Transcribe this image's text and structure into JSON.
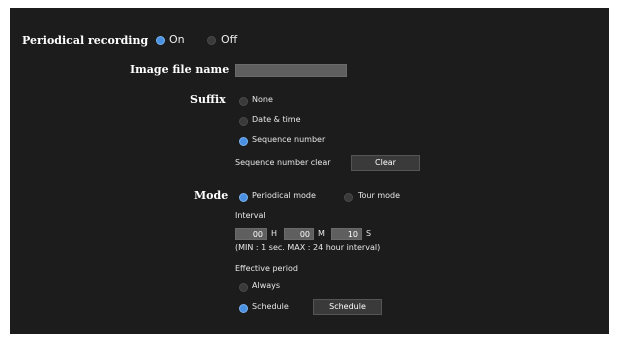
{
  "periodical_recording": {
    "label": "Periodical recording",
    "on_label": "On",
    "off_label": "Off",
    "selected": "On"
  },
  "image_file_name": {
    "label": "Image file name",
    "value": ""
  },
  "suffix": {
    "label": "Suffix",
    "options": [
      "None",
      "Date & time",
      "Sequence number"
    ],
    "selected": "Sequence number",
    "sequence_clear_label": "Sequence number clear",
    "clear_button": "Clear"
  },
  "mode": {
    "label": "Mode",
    "options": [
      "Periodical mode",
      "Tour mode"
    ],
    "selected": "Periodical mode",
    "interval_label": "Interval",
    "hours": "00",
    "h_unit": "H",
    "minutes": "00",
    "m_unit": "M",
    "seconds": "10",
    "s_unit": "S",
    "range_note": "(MIN : 1 sec. MAX : 24 hour interval)",
    "effective_period_label": "Effective period",
    "period_options": [
      "Always",
      "Schedule"
    ],
    "period_selected": "Schedule",
    "schedule_button": "Schedule"
  },
  "colors": {
    "background": "#1c1c1c",
    "radio_selected": "#4a90e2",
    "input": "#5f5f5f"
  }
}
